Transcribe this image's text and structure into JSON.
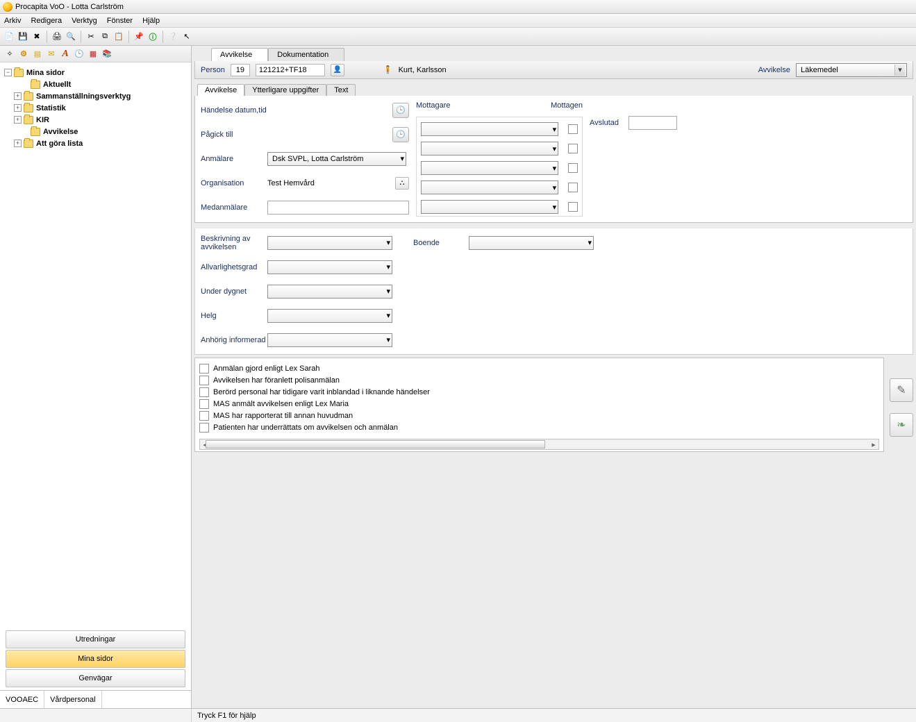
{
  "window_title": "Procapita VoO - Lotta Carlström",
  "menu": [
    "Arkiv",
    "Redigera",
    "Verktyg",
    "Fönster",
    "Hjälp"
  ],
  "toolbar_icons": [
    "new-file-icon",
    "save-icon",
    "delete-icon",
    "print-icon",
    "binoculars-icon",
    "cut-icon",
    "copy-icon",
    "paste-icon",
    "pin-icon",
    "info-icon",
    "help-icon",
    "pointer-icon"
  ],
  "side_toolbar_icons": [
    "wand-icon",
    "sliders-icon",
    "badge-icon",
    "mail-icon",
    "script-a-icon",
    "clock-icon",
    "chart-icon",
    "book-icon"
  ],
  "tree": {
    "root": "Mina sidor",
    "items": [
      {
        "label": "Aktuellt",
        "bold": true,
        "expand": ""
      },
      {
        "label": "Sammanställningsverktyg",
        "bold": true,
        "expand": "+"
      },
      {
        "label": "Statistik",
        "bold": true,
        "expand": "+"
      },
      {
        "label": "KIR",
        "bold": true,
        "expand": "+"
      },
      {
        "label": "Avvikelse",
        "bold": true,
        "expand": ""
      },
      {
        "label": "Att göra lista",
        "bold": true,
        "expand": "+"
      }
    ]
  },
  "side_buttons": {
    "b1": "Utredningar",
    "b2": "Mina sidor",
    "b3": "Genvägar"
  },
  "left_status": {
    "code": "VOOAEC",
    "role": "Vårdpersonal"
  },
  "page_tabs": {
    "t1": "Avvikelse",
    "t2": "Dokumentation"
  },
  "person_row": {
    "person_label": "Person",
    "id1": "19",
    "id2": "121212+TF18",
    "name": "Kurt, Karlsson",
    "avvikelse_label": "Avvikelse",
    "avvikelse_value": "Läkemedel"
  },
  "sub_tabs": [
    "Avvikelse",
    "Ytterligare uppgifter",
    "Text"
  ],
  "form": {
    "handelse": "Händelse datum,tid",
    "pagick": "Pågick till",
    "anmalare": "Anmälare",
    "anmalare_val": "Dsk SVPL, Lotta Carlström",
    "organisation": "Organisation",
    "organisation_val": "Test Hemvård",
    "medanmalare": "Medanmälare",
    "mottagare": "Mottagare",
    "mottagen": "Mottagen",
    "avslutad": "Avslutad",
    "beskrivning": "Beskrivning av avvikelsen",
    "boende": "Boende",
    "allvar": "Allvarlighetsgrad",
    "dygn": "Under dygnet",
    "helg": "Helg",
    "anhorig": "Anhörig informerad"
  },
  "checks": [
    "Anmälan gjord enligt Lex Sarah",
    "Avvikelsen har föranlett polisanmälan",
    "Berörd personal har tidigare varit inblandad i liknande händelser",
    "MAS anmält avvikelsen enligt Lex Maria",
    "MAS har rapporterat till annan huvudman",
    "Patienten har underrättats om avvikelsen och anmälan"
  ],
  "status_hint": "Tryck F1 för hjälp"
}
